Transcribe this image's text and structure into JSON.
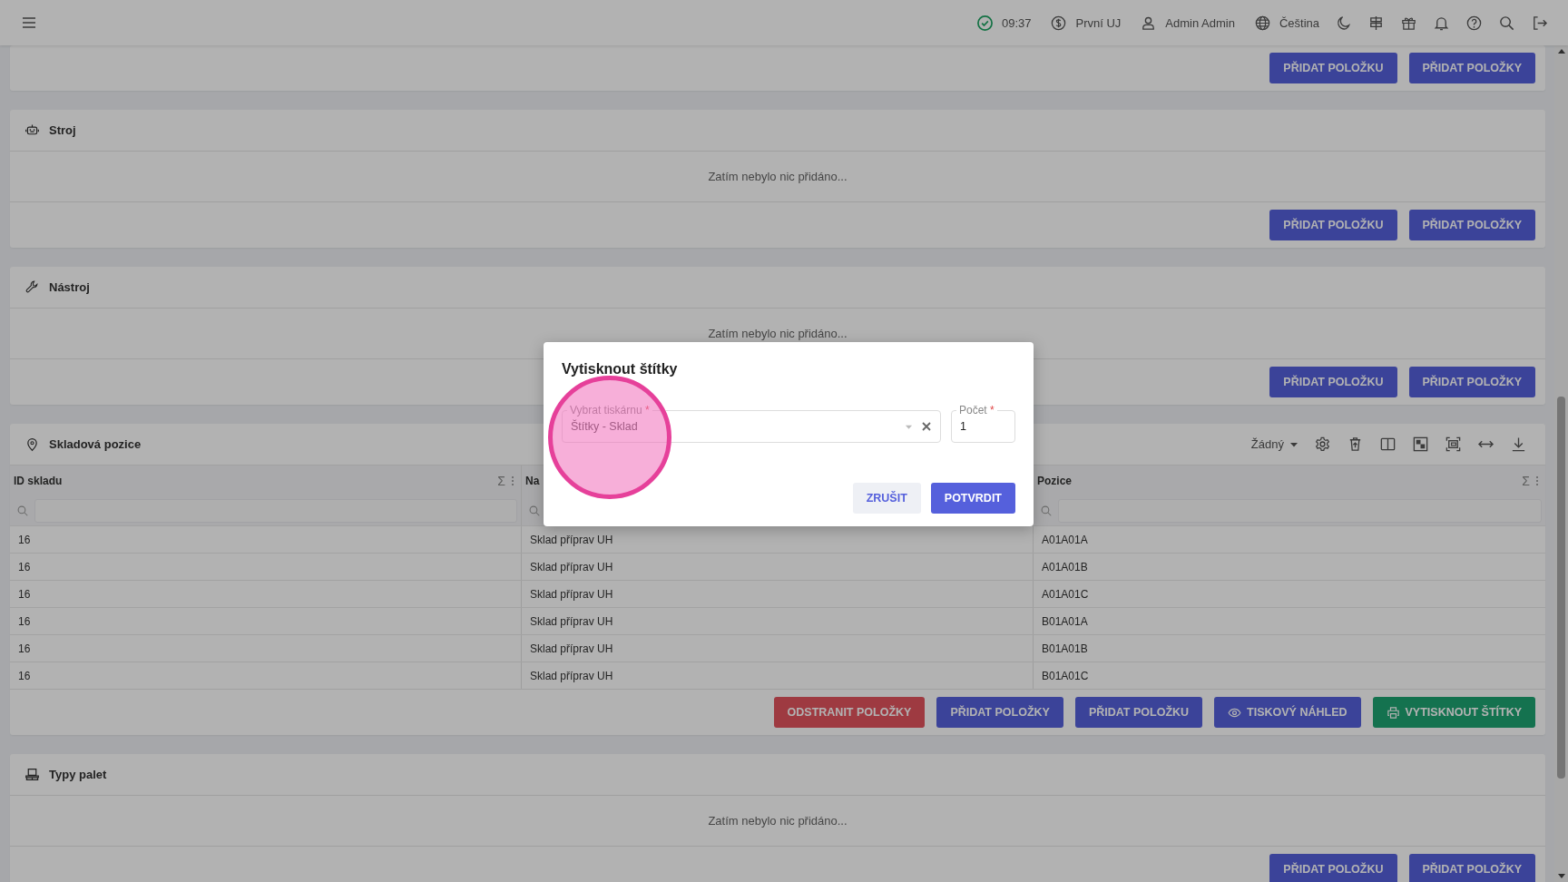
{
  "topbar": {
    "time": "09:37",
    "company": "První UJ",
    "user": "Admin Admin",
    "language": "Čeština"
  },
  "sections": [
    {
      "kind": "footer_only",
      "buttons": [
        {
          "label": "PŘIDAT POLOŽKU",
          "kind": "primary"
        },
        {
          "label": "PŘIDAT POLOŽKY",
          "kind": "primary"
        }
      ]
    },
    {
      "kind": "empty",
      "title": "Stroj",
      "empty_text": "Zatím nebylo nic přidáno...",
      "buttons": [
        {
          "label": "PŘIDAT POLOŽKU",
          "kind": "primary"
        },
        {
          "label": "PŘIDAT POLOŽKY",
          "kind": "primary"
        }
      ]
    },
    {
      "kind": "empty",
      "title": "Nástroj",
      "empty_text": "Zatím nebylo nic přidáno...",
      "buttons": [
        {
          "label": "PŘIDAT POLOŽKU",
          "kind": "primary"
        },
        {
          "label": "PŘIDAT POLOŽKY",
          "kind": "primary"
        }
      ]
    },
    {
      "kind": "table",
      "title": "Skladová pozice",
      "view": "Žádný",
      "columns": [
        {
          "label": "ID skladu",
          "aggregate": "Σ"
        },
        {
          "label": "Na"
        },
        {
          "label": "Pozice",
          "aggregate": "Σ"
        }
      ],
      "rows": [
        [
          "16",
          "Sklad příprav UH",
          "A01A01A"
        ],
        [
          "16",
          "Sklad příprav UH",
          "A01A01B"
        ],
        [
          "16",
          "Sklad příprav UH",
          "A01A01C"
        ],
        [
          "16",
          "Sklad příprav UH",
          "B01A01A"
        ],
        [
          "16",
          "Sklad příprav UH",
          "B01A01B"
        ],
        [
          "16",
          "Sklad příprav UH",
          "B01A01C"
        ]
      ],
      "buttons": [
        {
          "label": "ODSTRANIT POLOŽKY",
          "kind": "danger"
        },
        {
          "label": "PŘIDAT POLOŽKY",
          "kind": "primary"
        },
        {
          "label": "PŘIDAT POLOŽKU",
          "kind": "primary"
        },
        {
          "label": "TISKOVÝ NÁHLED",
          "kind": "preview"
        },
        {
          "label": "VYTISKNOUT ŠTÍTKY",
          "kind": "print"
        }
      ]
    },
    {
      "kind": "empty",
      "title": "Typy palet",
      "empty_text": "Zatím nebylo nic přidáno...",
      "buttons": [
        {
          "label": "PŘIDAT POLOŽKU",
          "kind": "primary"
        },
        {
          "label": "PŘIDAT POLOŽKY",
          "kind": "primary"
        }
      ]
    }
  ],
  "dialog": {
    "title": "Vytisknout štítky",
    "printer": {
      "label": "Vybrat tiskárnu",
      "required_mark": "*",
      "value": "Štítky - Sklad"
    },
    "count": {
      "label": "Počet",
      "required_mark": "*",
      "value": "1"
    },
    "buttons": [
      {
        "label": "ZRUŠIT",
        "kind": "secondary"
      },
      {
        "label": "POTVRDIT",
        "kind": "primary"
      }
    ]
  }
}
